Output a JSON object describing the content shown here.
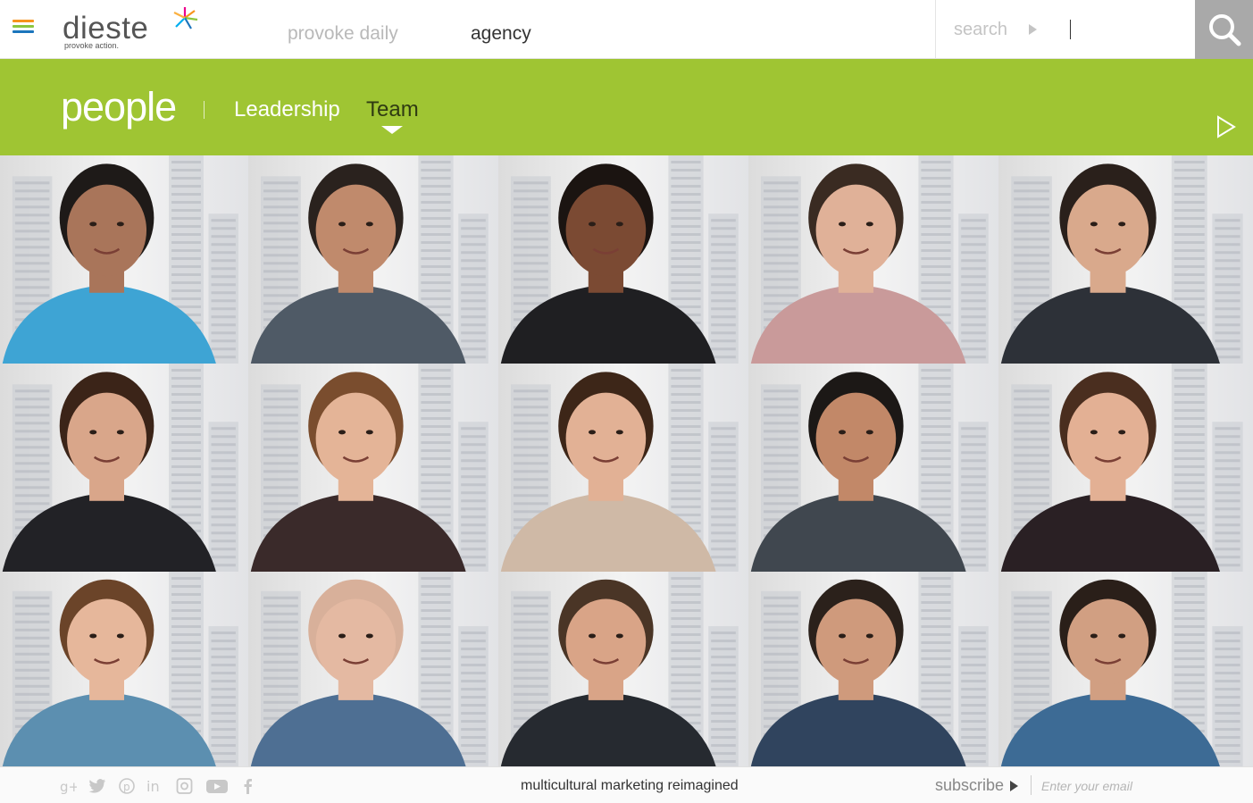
{
  "header": {
    "logo_word": "dieste",
    "logo_tagline": "provoke action.",
    "nav": [
      {
        "label": "provoke daily"
      },
      {
        "label": "agency"
      }
    ],
    "search_label": "search",
    "menu_icon": "hamburger-menu-icon",
    "search_icon": "magnifier-icon"
  },
  "section": {
    "title": "people",
    "tabs": [
      {
        "label": "Leadership",
        "active": false
      },
      {
        "label": "Team",
        "active": true
      }
    ],
    "next_icon": "play-outline-icon"
  },
  "colors": {
    "brand_green": "#9fc533",
    "logo_stripes": [
      "#f7941d",
      "#8cc63f",
      "#1b75bc",
      "#ec008c"
    ]
  },
  "team_grid": {
    "rows": 3,
    "columns": 5,
    "photos": [
      {
        "shirt": "#3ea4d4",
        "skin": "#a9755a",
        "hair": "#1e1a18"
      },
      {
        "shirt": "#4f5a66",
        "skin": "#c08a6c",
        "hair": "#2a221e"
      },
      {
        "shirt": "#1f1f22",
        "skin": "#7b4a33",
        "hair": "#1b1411"
      },
      {
        "shirt": "#c99a9a",
        "skin": "#e0b198",
        "hair": "#3a2b22"
      },
      {
        "shirt": "#2d3138",
        "skin": "#d9a98c",
        "hair": "#2a201b"
      },
      {
        "shirt": "#222226",
        "skin": "#d9a68a",
        "hair": "#3b2418"
      },
      {
        "shirt": "#3a2a2a",
        "skin": "#e4b497",
        "hair": "#7a4d2e"
      },
      {
        "shirt": "#cfb9a6",
        "skin": "#e2b195",
        "hair": "#3d2618"
      },
      {
        "shirt": "#40474f",
        "skin": "#c28868",
        "hair": "#1c1816"
      },
      {
        "shirt": "#2a2024",
        "skin": "#e3b094",
        "hair": "#4a2e1f"
      },
      {
        "shirt": "#5c8fb0",
        "skin": "#e6b79b",
        "hair": "#6b4429"
      },
      {
        "shirt": "#4e6f93",
        "skin": "#e4b9a2",
        "hair": "#d8b09a"
      },
      {
        "shirt": "#262a30",
        "skin": "#d9a487",
        "hair": "#4a3526"
      },
      {
        "shirt": "#30445e",
        "skin": "#cf9a7c",
        "hair": "#2b211b"
      },
      {
        "shirt": "#3d6b95",
        "skin": "#d19f82",
        "hair": "#2a1f19"
      }
    ]
  },
  "footer": {
    "social_icons": [
      "google-plus-icon",
      "twitter-icon",
      "pinterest-icon",
      "linkedin-icon",
      "instagram-icon",
      "youtube-icon",
      "facebook-icon"
    ],
    "tagline": "multicultural marketing reimagined",
    "subscribe_label": "subscribe",
    "email_placeholder": "Enter your email"
  }
}
